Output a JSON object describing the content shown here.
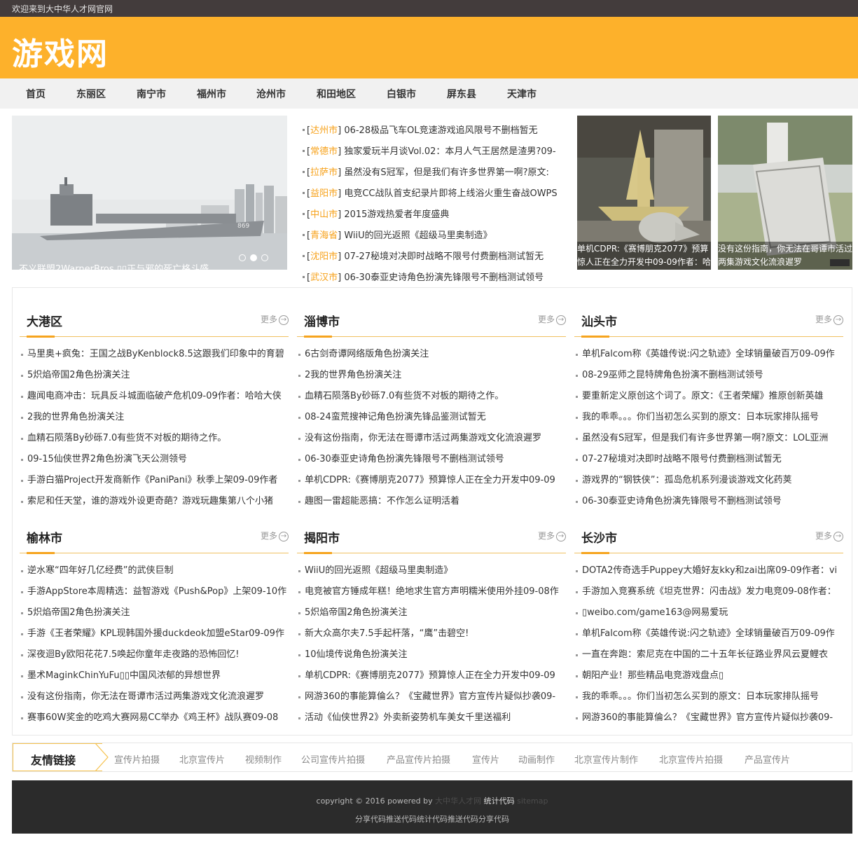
{
  "topbar": {
    "welcome": "欢迎来到大中华人才网官网"
  },
  "header": {
    "logo": "游戏网"
  },
  "nav": [
    "首页",
    "东丽区",
    "南宁市",
    "福州市",
    "沧州市",
    "和田地区",
    "白银市",
    "屏东县",
    "天津市"
  ],
  "slider": {
    "caption": "不义联盟2WarnerBros.▯▯正与邪的死亡格斗盛",
    "dots": 3,
    "active_dot": 2,
    "hull_number": "869"
  },
  "headlines": [
    {
      "tag": "达州市",
      "text": "06-28极品飞车OL竞速游戏追风限号不删档暂无"
    },
    {
      "tag": "常德市",
      "text": "独家爱玩半月谈Vol.02：本月人气王居然是渣男?09-"
    },
    {
      "tag": "拉萨市",
      "text": "虽然没有S冠军，但是我们有许多世界第一啊?原文:"
    },
    {
      "tag": "益阳市",
      "text": "电竞CC战队首支纪录片即将上线浴火重生奋战OWPS"
    },
    {
      "tag": "中山市",
      "text": "2015游戏热爱者年度盛典"
    },
    {
      "tag": "青海省",
      "text": "WiiU的回光返照《超级马里奥制造》"
    },
    {
      "tag": "沈阳市",
      "text": "07-27秘境对决即时战略不限号付费删档测试暂无"
    },
    {
      "tag": "武汉市",
      "text": "06-30泰亚史诗角色扮演先锋限号不删档测试领号"
    }
  ],
  "pics": [
    {
      "caption": "单机CDPR:《赛博朋克2077》预算惊人正在全力开发中09-09作者：哈"
    },
    {
      "caption": "没有这份指南，你无法在哥谭市活过两集游戏文化流浪遲罗"
    }
  ],
  "more_label": "更多",
  "columns": [
    {
      "title": "大港区",
      "items": [
        "马里奥+疯兔：王国之战ByKenblock8.5这跟我们印象中的育碧",
        "5炽焰帝国2角色扮演关注",
        "趣闻电商冲击：玩具反斗城面临破产危机09-09作者：哈哈大侠",
        "2我的世界角色扮演关注",
        "血精石陨落By砂砾7.0有些货不对板的期待之作。",
        "09-15仙侠世界2角色扮演飞天公测领号",
        "手游白猫Project开发商新作《PaniPani》秋季上架09-09作者",
        "索尼和任天堂，谁的游戏外设更奇葩？游戏玩趣集第八个小猪"
      ]
    },
    {
      "title": "淄博市",
      "items": [
        "6古剑奇谭网络版角色扮演关注",
        "2我的世界角色扮演关注",
        "血精石陨落By砂砾7.0有些货不对板的期待之作。",
        "08-24蛮荒搜神记角色扮演先锋品鉴测试暂无",
        "没有这份指南，你无法在哥谭市活过两集游戏文化流浪遲罗",
        "06-30泰亚史诗角色扮演先锋限号不删档测试领号",
        "单机CDPR:《赛博朋克2077》预算惊人正在全力开发中09-09",
        "趣图一雷超能恶搞：不作怎么证明活着"
      ]
    },
    {
      "title": "汕头市",
      "items": [
        "单机Falcom称《英雄传说:闪之轨迹》全球销量破百万09-09作",
        "08-29巫师之昆特牌角色扮演不删档测试领号",
        "要重新定义原创这个词了。原文：《王者荣耀》推原创新英雄",
        "我的乖乖。。。你们当初怎么买到的原文：日本玩家排队摇号",
        "虽然没有S冠军，但是我们有许多世界第一啊?原文：LOL亚洲",
        "07-27秘境对决即时战略不限号付费删档测试暂无",
        "游戏界的“钢铁侠”：孤岛危机系列漫谈游戏文化药荚",
        "06-30泰亚史诗角色扮演先锋限号不删档测试领号"
      ]
    },
    {
      "title": "榆林市",
      "items": [
        "逆水寒“四年好几亿经费”的武侠巨制",
        "手游AppStore本周精选：益智游戏《Push&Pop》上架09-10作",
        "5炽焰帝国2角色扮演关注",
        "手游《王者荣耀》KPL现韩国外援duckdeok加盟eStar09-09作",
        "深夜迴By欧阳花花7.5唤起你童年走夜路的恐怖回忆!",
        "墨术MaginkChinYuFu▯▯中国风浓郁的异想世界",
        "没有这份指南，你无法在哥谭市活过两集游戏文化流浪遲罗",
        "赛事60W奖金的吃鸡大赛网易CC举办《鸡王杯》战队赛09-08"
      ]
    },
    {
      "title": "揭阳市",
      "items": [
        "WiiU的回光返照《超级马里奥制造》",
        "电竞被官方锤成年糕！绝地求生官方声明糯米使用外挂09-08作",
        "5炽焰帝国2角色扮演关注",
        "新大众高尔夫7.5手起杆落，“鹰”击碧空!",
        "10仙境传说角色扮演关注",
        "单机CDPR:《赛博朋克2077》预算惊人正在全力开发中09-09",
        "网游360的事能算倫么？《宝藏世界》官方宣传片疑似抄袭09-",
        "活动《仙侠世界2》外卖新姿势机车美女千里送福利"
      ]
    },
    {
      "title": "长沙市",
      "items": [
        "DOTA2传奇选手Puppey大婚好友kky和zai出席09-09作者：vi",
        "手游加入竞赛系统《坦克世界：闪击战》发力电竞09-08作者：",
        "▯weibo.com/game163@网易爱玩",
        "单机Falcom称《英雄传说:闪之轨迹》全球销量破百万09-09作",
        "一直在奔跑：索尼克在中国的二十五年长征路业界风云夏鲤衣",
        "朝阳产业！那些精品电竞游戏盘点▯",
        "我的乖乖。。。你们当初怎么买到的原文：日本玩家排队摇号",
        "网游360的事能算倫么？《宝藏世界》官方宣传片疑似抄袭09-"
      ]
    }
  ],
  "friends": {
    "title": "友情链接",
    "links": [
      "宣传片拍摄",
      "北京宣传片",
      "视频制作",
      "公司宣传片拍摄",
      "产品宣传片拍摄",
      "宣传片",
      "动画制作",
      "北京宣传片制作",
      "北京宣传片拍摄",
      "产品宣传片"
    ]
  },
  "footer": {
    "copyright": "copyright © 2016 powered by",
    "site_link": "大中华人才网",
    "stat_code": "统计代码",
    "sitemap": "sitemap",
    "line2": "分享代码推送代码统计代码推送代码分享代码"
  },
  "colors": {
    "brand": "#fdb12b",
    "tag": "#f7a21b",
    "topbar": "#433c3c",
    "footer": "#2b2b2b"
  }
}
